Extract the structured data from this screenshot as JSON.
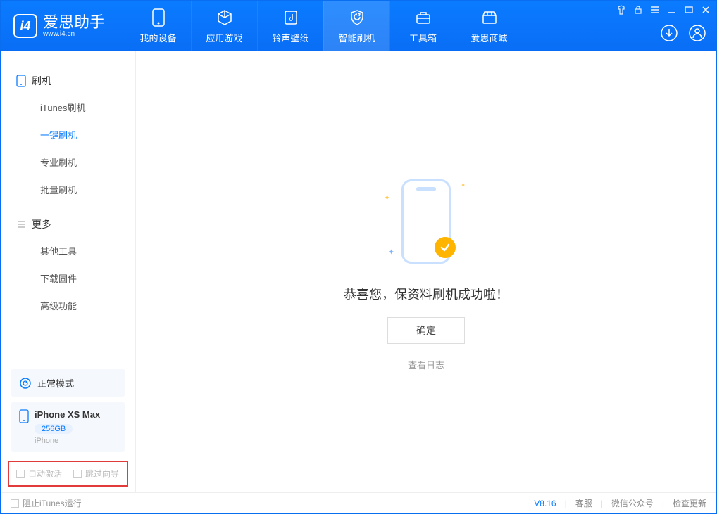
{
  "app": {
    "name": "爱思助手",
    "subtitle": "www.i4.cn"
  },
  "tabs": {
    "device": "我的设备",
    "apps": "应用游戏",
    "ring": "铃声壁纸",
    "flash": "智能刷机",
    "toolbox": "工具箱",
    "store": "爱思商城"
  },
  "sidebar": {
    "group1_title": "刷机",
    "items1": {
      "itunes": "iTunes刷机",
      "onekey": "一键刷机",
      "pro": "专业刷机",
      "batch": "批量刷机"
    },
    "group2_title": "更多",
    "items2": {
      "other": "其他工具",
      "firmware": "下载固件",
      "adv": "高级功能"
    }
  },
  "device": {
    "mode": "正常模式",
    "name": "iPhone XS Max",
    "capacity": "256GB",
    "type": "iPhone"
  },
  "checks": {
    "auto_activate": "自动激活",
    "skip_guide": "跳过向导"
  },
  "main": {
    "message": "恭喜您，保资料刷机成功啦！",
    "ok_button": "确定",
    "log_link": "查看日志"
  },
  "status": {
    "block_itunes": "阻止iTunes运行",
    "version": "V8.16",
    "support": "客服",
    "wechat": "微信公众号",
    "update": "检查更新"
  }
}
